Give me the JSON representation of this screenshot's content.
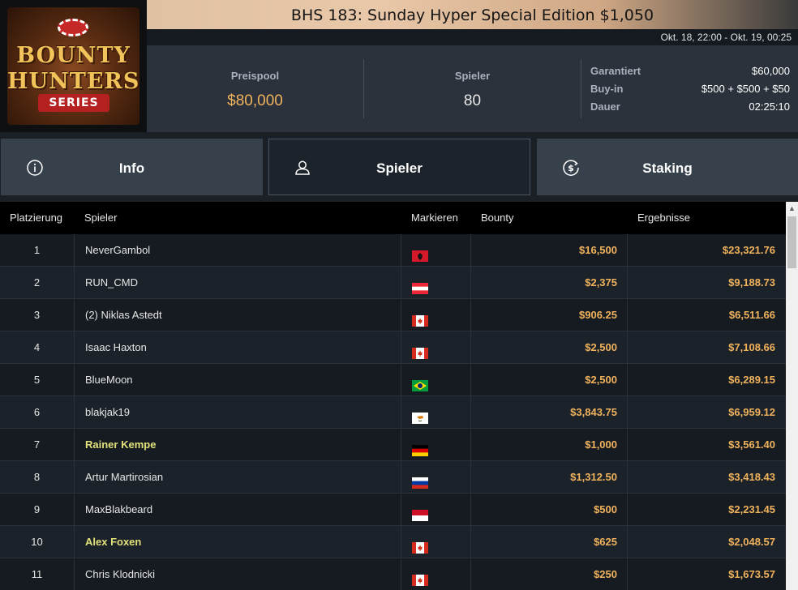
{
  "logo": {
    "line1": "BOUNTY",
    "line2": "HUNTERS",
    "line3": "SERIES"
  },
  "tournament": {
    "title": "BHS 183: Sunday Hyper Special Edition $1,050",
    "dates": "Okt. 18, 22:00 - Okt. 19, 00:25"
  },
  "stats": {
    "prizepool_label": "Preispool",
    "prizepool_value": "$80,000",
    "players_label": "Spieler",
    "players_value": "80"
  },
  "details": [
    {
      "key": "Garantiert",
      "value": "$60,000"
    },
    {
      "key": "Buy-in",
      "value": "$500 + $500 + $50"
    },
    {
      "key": "Dauer",
      "value": "02:25:10"
    }
  ],
  "tabs": [
    {
      "label": "Info",
      "icon": "info-icon",
      "active": false
    },
    {
      "label": "Spieler",
      "icon": "user-icon",
      "active": true
    },
    {
      "label": "Staking",
      "icon": "dollar-coin-icon",
      "active": false
    }
  ],
  "table": {
    "headers": [
      "Platzierung",
      "Spieler",
      "Markieren",
      "Bounty",
      "Ergebnisse"
    ],
    "rows": [
      {
        "rank": "1",
        "name": "NeverGambol",
        "flag": "albania-flag",
        "bounty": "$16,500",
        "result": "$23,321.76",
        "highlight": false
      },
      {
        "rank": "2",
        "name": "RUN_CMD",
        "flag": "austria-flag",
        "bounty": "$2,375",
        "result": "$9,188.73",
        "highlight": false
      },
      {
        "rank": "3",
        "name": "(2) Niklas Astedt",
        "flag": "canada-flag",
        "bounty": "$906.25",
        "result": "$6,511.66",
        "highlight": false
      },
      {
        "rank": "4",
        "name": "Isaac Haxton",
        "flag": "canada-flag",
        "bounty": "$2,500",
        "result": "$7,108.66",
        "highlight": false
      },
      {
        "rank": "5",
        "name": "BlueMoon",
        "flag": "brazil-flag",
        "bounty": "$2,500",
        "result": "$6,289.15",
        "highlight": false
      },
      {
        "rank": "6",
        "name": "blakjak19",
        "flag": "cyprus-flag",
        "bounty": "$3,843.75",
        "result": "$6,959.12",
        "highlight": false
      },
      {
        "rank": "7",
        "name": "Rainer Kempe",
        "flag": "germany-flag",
        "bounty": "$1,000",
        "result": "$3,561.40",
        "highlight": true
      },
      {
        "rank": "8",
        "name": "Artur Martirosian",
        "flag": "russia-flag",
        "bounty": "$1,312.50",
        "result": "$3,418.43",
        "highlight": false
      },
      {
        "rank": "9",
        "name": "MaxBlakbeard",
        "flag": "monaco-flag",
        "bounty": "$500",
        "result": "$2,231.45",
        "highlight": false
      },
      {
        "rank": "10",
        "name": "Alex Foxen",
        "flag": "canada-flag",
        "bounty": "$625",
        "result": "$2,048.57",
        "highlight": true
      },
      {
        "rank": "11",
        "name": "Chris Klodnicki",
        "flag": "canada-flag",
        "bounty": "$250",
        "result": "$1,673.57",
        "highlight": false
      }
    ]
  },
  "colors": {
    "accent_gold": "#f0b25c",
    "highlight_name": "#e2e27a",
    "panel": "#2b323b",
    "table_bg": "#161b21"
  }
}
